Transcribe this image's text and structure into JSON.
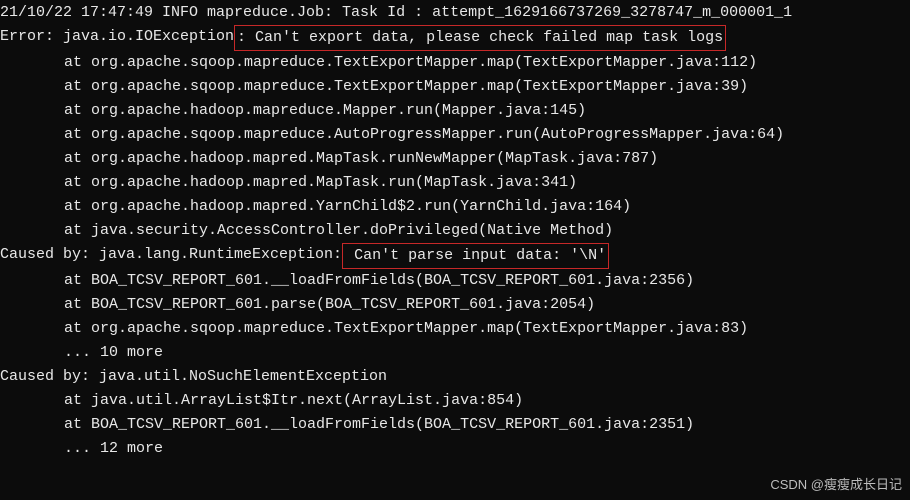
{
  "log": {
    "line0": "21/10/22 17:47:49 INFO mapreduce.Job: Task Id : attempt_1629166737269_3278747_m_000001_1",
    "errorPrefix": "Error: java.io.IOException",
    "errorHighlighted": ": Can't export data, please check failed map task logs",
    "stack1": [
      "at org.apache.sqoop.mapreduce.TextExportMapper.map(TextExportMapper.java:112)",
      "at org.apache.sqoop.mapreduce.TextExportMapper.map(TextExportMapper.java:39)",
      "at org.apache.hadoop.mapreduce.Mapper.run(Mapper.java:145)",
      "at org.apache.sqoop.mapreduce.AutoProgressMapper.run(AutoProgressMapper.java:64)",
      "at org.apache.hadoop.mapred.MapTask.runNewMapper(MapTask.java:787)",
      "at org.apache.hadoop.mapred.MapTask.run(MapTask.java:341)",
      "at org.apache.hadoop.mapred.YarnChild$2.run(YarnChild.java:164)",
      "at java.security.AccessController.doPrivileged(Native Method)"
    ],
    "caused1Prefix": "Caused by: java.lang.RuntimeException:",
    "caused1Highlighted": " Can't parse input data: '\\N'",
    "stack2": [
      "at BOA_TCSV_REPORT_601.__loadFromFields(BOA_TCSV_REPORT_601.java:2356)",
      "at BOA_TCSV_REPORT_601.parse(BOA_TCSV_REPORT_601.java:2054)",
      "at org.apache.sqoop.mapreduce.TextExportMapper.map(TextExportMapper.java:83)",
      "... 10 more"
    ],
    "caused2": "Caused by: java.util.NoSuchElementException",
    "stack3": [
      "at java.util.ArrayList$Itr.next(ArrayList.java:854)",
      "at BOA_TCSV_REPORT_601.__loadFromFields(BOA_TCSV_REPORT_601.java:2351)",
      "... 12 more"
    ]
  },
  "watermark": "CSDN @瘦瘦成长日记"
}
